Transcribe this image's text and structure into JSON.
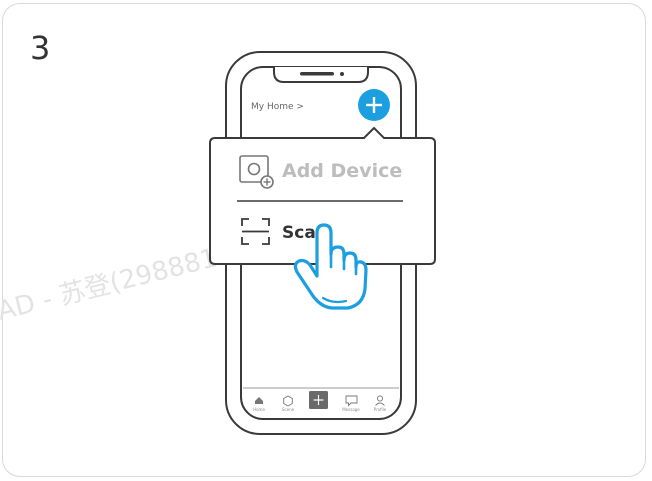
{
  "step_number": "3",
  "header": {
    "home_link": "My Home >"
  },
  "popup": {
    "add_device_label": "Add Device",
    "scan_label": "Scan"
  },
  "tabbar": {
    "items": [
      {
        "label": "Home",
        "icon": "home-icon"
      },
      {
        "label": "Scene",
        "icon": "scene-icon"
      },
      {
        "label": "",
        "icon": "plus-icon"
      },
      {
        "label": "Message",
        "icon": "message-icon"
      },
      {
        "label": "Profile",
        "icon": "profile-icon"
      }
    ]
  },
  "watermark": "AD - 苏登(2988810",
  "colors": {
    "accent": "#1b9fe0",
    "outline": "#3a3a3a",
    "popup_bg": "#ffffff"
  }
}
